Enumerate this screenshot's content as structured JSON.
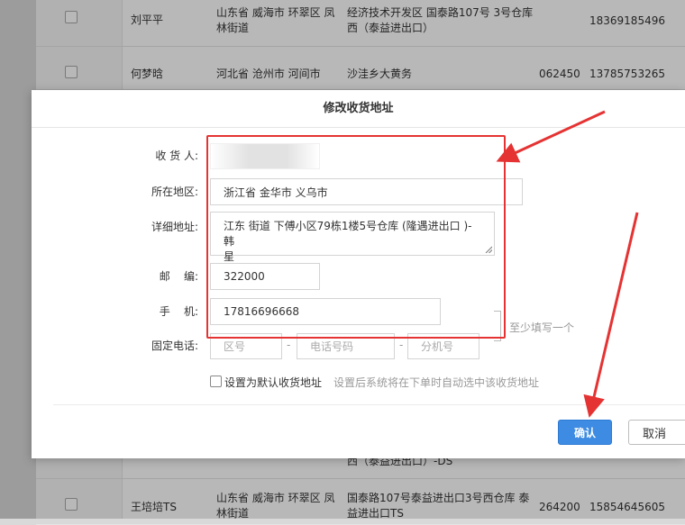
{
  "background_table": {
    "rows": [
      {
        "name": "刘平平",
        "region": [
          "山东省 威海市 环翠区 凤",
          "林街道"
        ],
        "address": [
          "经济技术开发区 国泰路107号 3号仓库",
          "西（泰益进出口）"
        ],
        "zip": "",
        "phone": "18369185496"
      },
      {
        "name": "何梦晗",
        "region": [
          "河北省 沧州市 河间市"
        ],
        "address": [
          "沙洼乡大黄务"
        ],
        "zip": "062450",
        "phone": "13785753265"
      },
      {
        "name": "",
        "region": [
          ""
        ],
        "address": [
          "西（泰益进出口）-DS"
        ],
        "zip": "",
        "phone": ""
      },
      {
        "name": "王培培TS",
        "region": [
          "山东省 威海市 环翠区 凤",
          "林街道"
        ],
        "address": [
          "国泰路107号泰益进出口3号西仓库 泰",
          "益进出口TS"
        ],
        "zip": "264200",
        "phone": "15854645605"
      }
    ]
  },
  "dialog": {
    "title": "修改收货地址",
    "fields": {
      "receiver": {
        "label": "收 货 人:",
        "value": ""
      },
      "region": {
        "label": "所在地区:",
        "value": "浙江省 金华市 义乌市"
      },
      "address": {
        "label": "详细地址:",
        "value_line1": "江东 街道 下傅小区79栋1楼5号仓库 (隆遇进出口 )-韩",
        "value_line2": "星"
      },
      "zip": {
        "label": "邮    编:",
        "value": "322000"
      },
      "mobile": {
        "label": "手    机:",
        "value": "17816696668"
      },
      "landline": {
        "label": "固定电话:",
        "area_placeholder": "区号",
        "number_placeholder": "电话号码",
        "ext_placeholder": "分机号",
        "separator": "-"
      }
    },
    "contact_hint": "至少填写一个",
    "default_checkbox": {
      "label": "设置为默认收货地址",
      "hint": "设置后系统将在下单时自动选中该收货地址",
      "checked": false
    },
    "buttons": {
      "confirm": "确认",
      "cancel": "取消"
    }
  },
  "colors": {
    "primary": "#3d8be2",
    "annotation": "#e53333"
  }
}
